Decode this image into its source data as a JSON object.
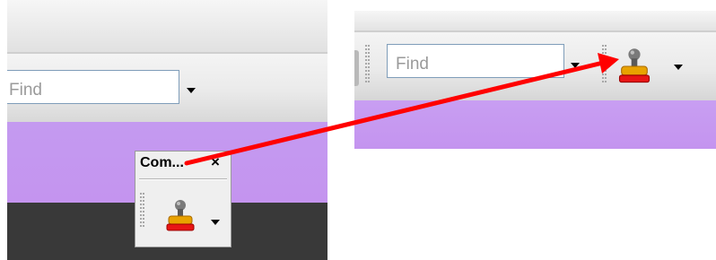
{
  "left_panel": {
    "find": {
      "placeholder": "Find"
    },
    "floating_toolbar": {
      "title": "Com...",
      "close_glyph": "×",
      "stamp_icon": "stamp-icon"
    }
  },
  "right_panel": {
    "find": {
      "placeholder": "Find"
    },
    "stamp_icon": "stamp-icon"
  },
  "colors": {
    "toolbar_bg": "#eaeaea",
    "purple_bg": "#c494ef",
    "dark_bg": "#393939",
    "input_border": "#7f9db9",
    "arrow": "#ff0000",
    "stamp_gold": "#e8a200",
    "stamp_red": "#e81515"
  }
}
